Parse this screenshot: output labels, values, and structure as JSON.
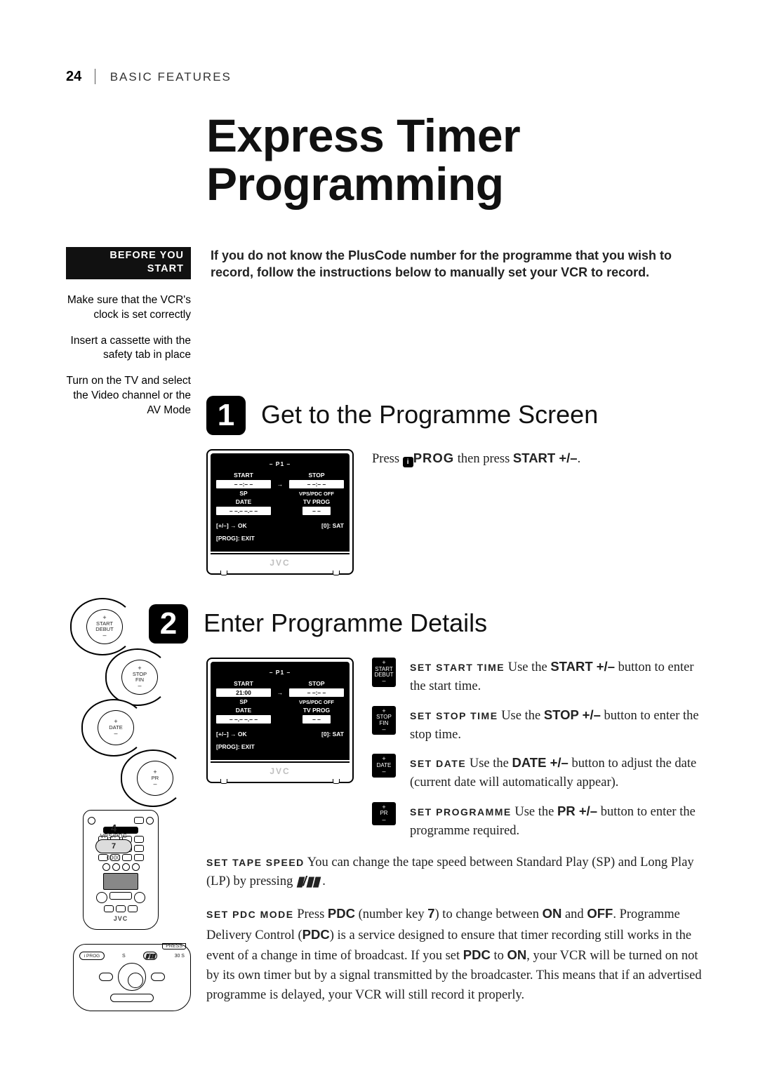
{
  "header": {
    "page_number": "24",
    "section": "BASIC FEATURES"
  },
  "title_line1": "Express Timer",
  "title_line2": "Programming",
  "before_badge": "BEFORE YOU START",
  "before_items": [
    "Make sure that the VCR's clock is set correctly",
    "Insert a cassette with the safety tab in place",
    "Turn on the TV and select the Video channel or the AV Mode"
  ],
  "intro": "If you do not know the PlusCode number for the programme that you wish to record, follow the instructions below to manually set your VCR to record.",
  "step1": {
    "num": "1",
    "title": "Get to the Programme Screen",
    "body_prefix": "Press ",
    "prog_label": "PROG",
    "body_mid": " then press ",
    "start_label": "START +/–",
    "body_suffix": ".",
    "screen": {
      "p1": "– P1 –",
      "start_label": "START",
      "start_val": "– –:– –",
      "stop_label": "STOP",
      "stop_val": "– –:– –",
      "sp": "SP",
      "vps": "VPS/PDC OFF",
      "date_label": "DATE",
      "date_val": "– –.– –.– –",
      "tvprog_label": "TV PROG",
      "tvprog_val": "– –",
      "hint_l": "[+/–] → OK",
      "hint_r": "[0]: SAT",
      "hint_exit": "[PROG]: EXIT",
      "brand": "JVC"
    }
  },
  "step2": {
    "num": "2",
    "title": "Enter Programme Details",
    "screen": {
      "p1": "– P1 –",
      "start_label": "START",
      "start_val": "21:00",
      "stop_label": "STOP",
      "stop_val": "– –:– –",
      "sp": "SP",
      "vps": "VPS/PDC OFF",
      "date_label": "DATE",
      "date_val": "– –.– –.– –",
      "tvprog_label": "TV PROG",
      "tvprog_val": "– –",
      "hint_l": "[+/–] → OK",
      "hint_r": "[0]: SAT",
      "hint_exit": "[PROG]: EXIT",
      "brand": "JVC"
    },
    "details": [
      {
        "icon": {
          "plus": "+",
          "label1": "START",
          "label2": "DEBUT",
          "minus": "–"
        },
        "caps": "SET START TIME",
        "t1": "  Use the  ",
        "button": "START +/–",
        "t2": " button to enter the start time."
      },
      {
        "icon": {
          "plus": "+",
          "label1": "STOP",
          "label2": "FIN",
          "minus": "–"
        },
        "caps": "SET STOP TIME",
        "t1": "  Use the ",
        "button": "STOP +/–",
        "t2": " button to enter the stop time."
      },
      {
        "icon": {
          "plus": "+",
          "label1": "DATE",
          "label2": "",
          "minus": "–"
        },
        "caps": "SET DATE",
        "t1": "  Use the ",
        "button": "DATE +/–",
        "t2": " button to adjust the date (current date will automatically appear)."
      },
      {
        "icon": {
          "plus": "+",
          "label1": "PR",
          "label2": "",
          "minus": "–"
        },
        "caps": "SET PROGRAMME",
        "t1": "  Use the ",
        "button": "PR +/–",
        "t2": " button to enter the programme required."
      }
    ],
    "tape_speed": {
      "caps": "SET TAPE SPEED",
      "t1": "  You can change the tape speed between Standard Play (SP) and Long Play (LP) by pressing ",
      "icon_alt": "▮/▮▮",
      "t2": " ."
    },
    "pdc": {
      "caps": "SET PDC MODE",
      "t1": "  Press ",
      "k_pdc": "PDC",
      "t2": " (number key ",
      "k_7": "7",
      "t3": ") to change between ",
      "k_on": "ON",
      "t4": " and ",
      "k_off": "OFF",
      "t5": ". Programme Delivery Control (",
      "k_pdc2": "PDC",
      "t6": ") is a service designed to ensure that timer recording still works in the event of a change in time of broadcast. If you set ",
      "k_pdc3": "PDC",
      "t7": " to ",
      "k_on2": "ON",
      "t8": ", your VCR will be turned on not by its own timer but by a signal transmitted by the broadcaster. This means that if an advertised programme is delayed, your VCR will still record it properly."
    }
  },
  "remote": {
    "knobs": [
      {
        "plus": "+",
        "l1": "START",
        "l2": "DEBUT",
        "minus": "–"
      },
      {
        "plus": "+",
        "l1": "STOP",
        "l2": "FIN",
        "minus": "–"
      },
      {
        "plus": "+",
        "l1": "DATE",
        "l2": "",
        "minus": "–"
      },
      {
        "plus": "+",
        "l1": "PR",
        "l2": "",
        "minus": "–"
      }
    ],
    "vps": {
      "num_top": "4",
      "label_top": "VPS/PDC",
      "pill": "7",
      "label_bot": "0000"
    },
    "brand": "JVC",
    "flip": {
      "press": "PRESS",
      "prog_num": "i",
      "prog": "PROG",
      "thirty": "30 S",
      "tape_icon": "▮/▮▮"
    }
  }
}
